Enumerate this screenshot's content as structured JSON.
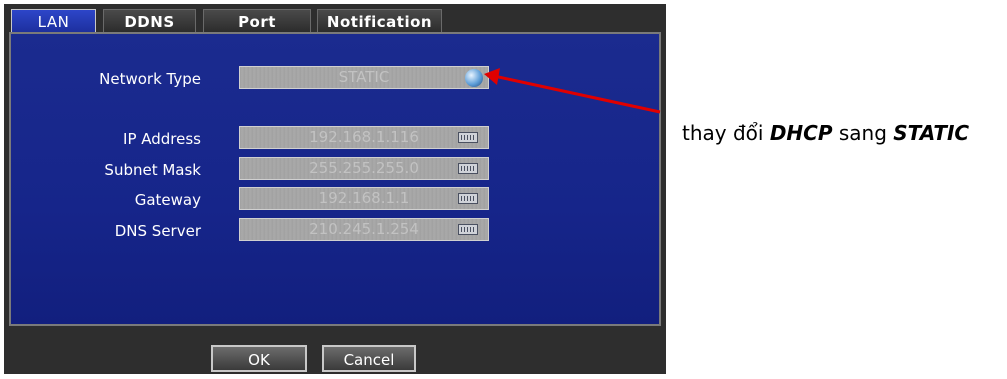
{
  "tabs": [
    {
      "label": "LAN",
      "active": true
    },
    {
      "label": "DDNS",
      "active": false
    },
    {
      "label": "Port",
      "active": false
    },
    {
      "label": "Notification",
      "active": false
    }
  ],
  "fields": {
    "network_type": {
      "label": "Network Type",
      "value": "STATIC",
      "icon": "globe-icon"
    },
    "ip_address": {
      "label": "IP Address",
      "value": "192.168.1.116",
      "icon": "keyboard-icon"
    },
    "subnet_mask": {
      "label": "Subnet Mask",
      "value": "255.255.255.0",
      "icon": "keyboard-icon"
    },
    "gateway": {
      "label": "Gateway",
      "value": "192.168.1.1",
      "icon": "keyboard-icon"
    },
    "dns_server": {
      "label": "DNS Server",
      "value": "210.245.1.254",
      "icon": "keyboard-icon"
    }
  },
  "buttons": {
    "ok": "OK",
    "cancel": "Cancel"
  },
  "annotation": {
    "prefix": "thay đổi ",
    "from": "DHCP",
    "middle": " sang ",
    "to": "STATIC"
  },
  "colors": {
    "panel_bg": "#1b2b8f",
    "frame_bg": "#2e2e2e",
    "arrow": "#e00000"
  }
}
